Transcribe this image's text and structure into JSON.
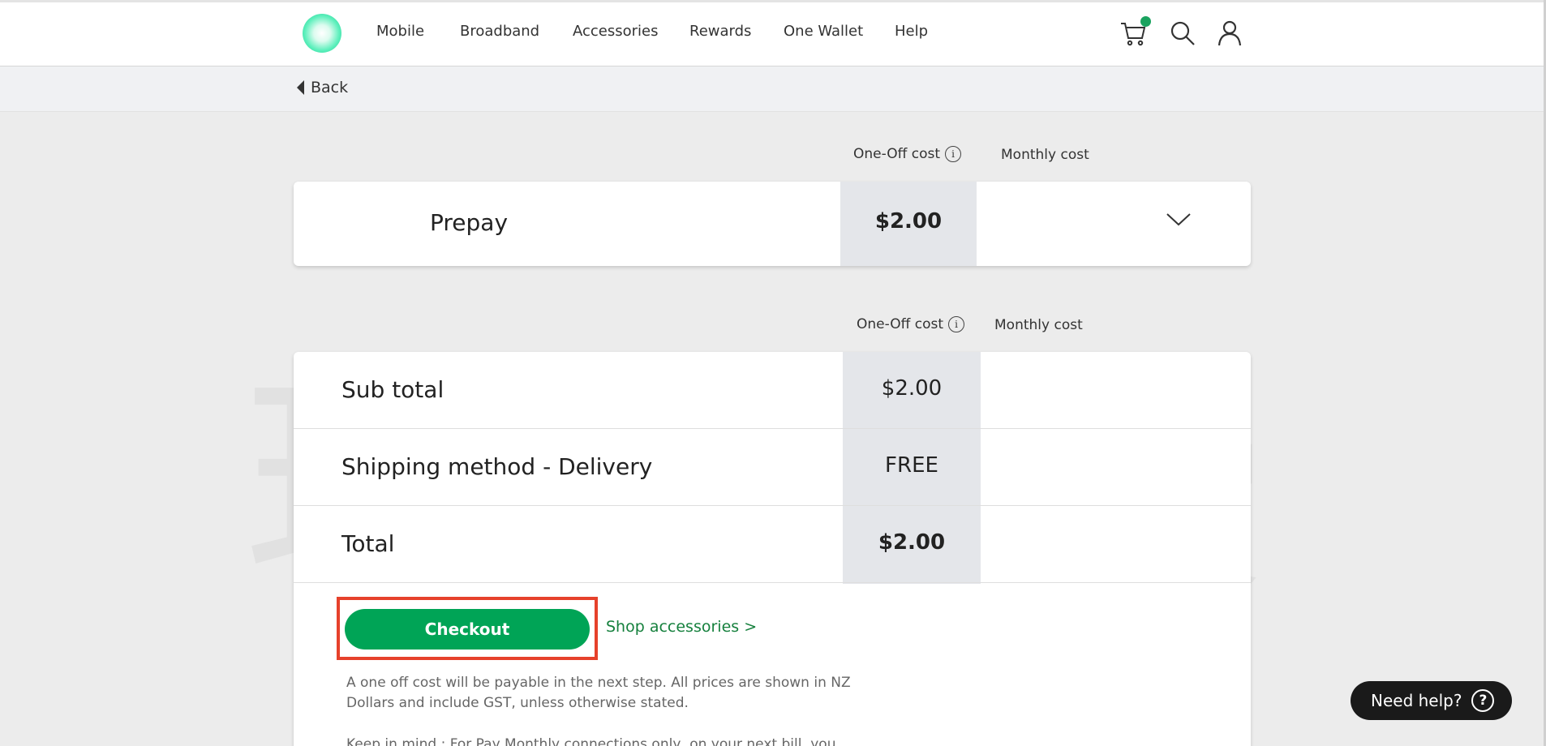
{
  "nav": {
    "items": [
      {
        "label": "Mobile",
        "name": "nav-mobile"
      },
      {
        "label": "Broadband",
        "name": "nav-broadband"
      },
      {
        "label": "Accessories",
        "name": "nav-accessories"
      },
      {
        "label": "Rewards",
        "name": "nav-rewards"
      },
      {
        "label": "One Wallet",
        "name": "nav-one-wallet"
      },
      {
        "label": "Help",
        "name": "nav-help"
      }
    ],
    "icons": [
      "cart-icon",
      "search-icon",
      "user-icon"
    ]
  },
  "back": {
    "label": "Back"
  },
  "columns": {
    "one_off": "One-Off cost",
    "monthly": "Monthly cost"
  },
  "plan": {
    "title": "Prepay",
    "one_off_price": "$2.00"
  },
  "summary": {
    "rows": [
      {
        "label": "Sub total",
        "value": "$2.00"
      },
      {
        "label": "Shipping method - Delivery",
        "value": "FREE"
      },
      {
        "label": "Total",
        "value": "$2.00"
      }
    ]
  },
  "actions": {
    "checkout": "Checkout",
    "shop_accessories": "Shop accessories >"
  },
  "notes": {
    "one_off": "A one off cost will be payable in the next step. All prices are shown in NZ Dollars and include GST, unless otherwise stated.",
    "keep_in_mind": "Keep in mind : For Pay Monthly connections only, on your next bill, you"
  },
  "help": {
    "label": "Need help?"
  },
  "watermark": "玩卡教授",
  "colors": {
    "brand_green": "#00a456",
    "highlight_red": "#e6412b"
  }
}
